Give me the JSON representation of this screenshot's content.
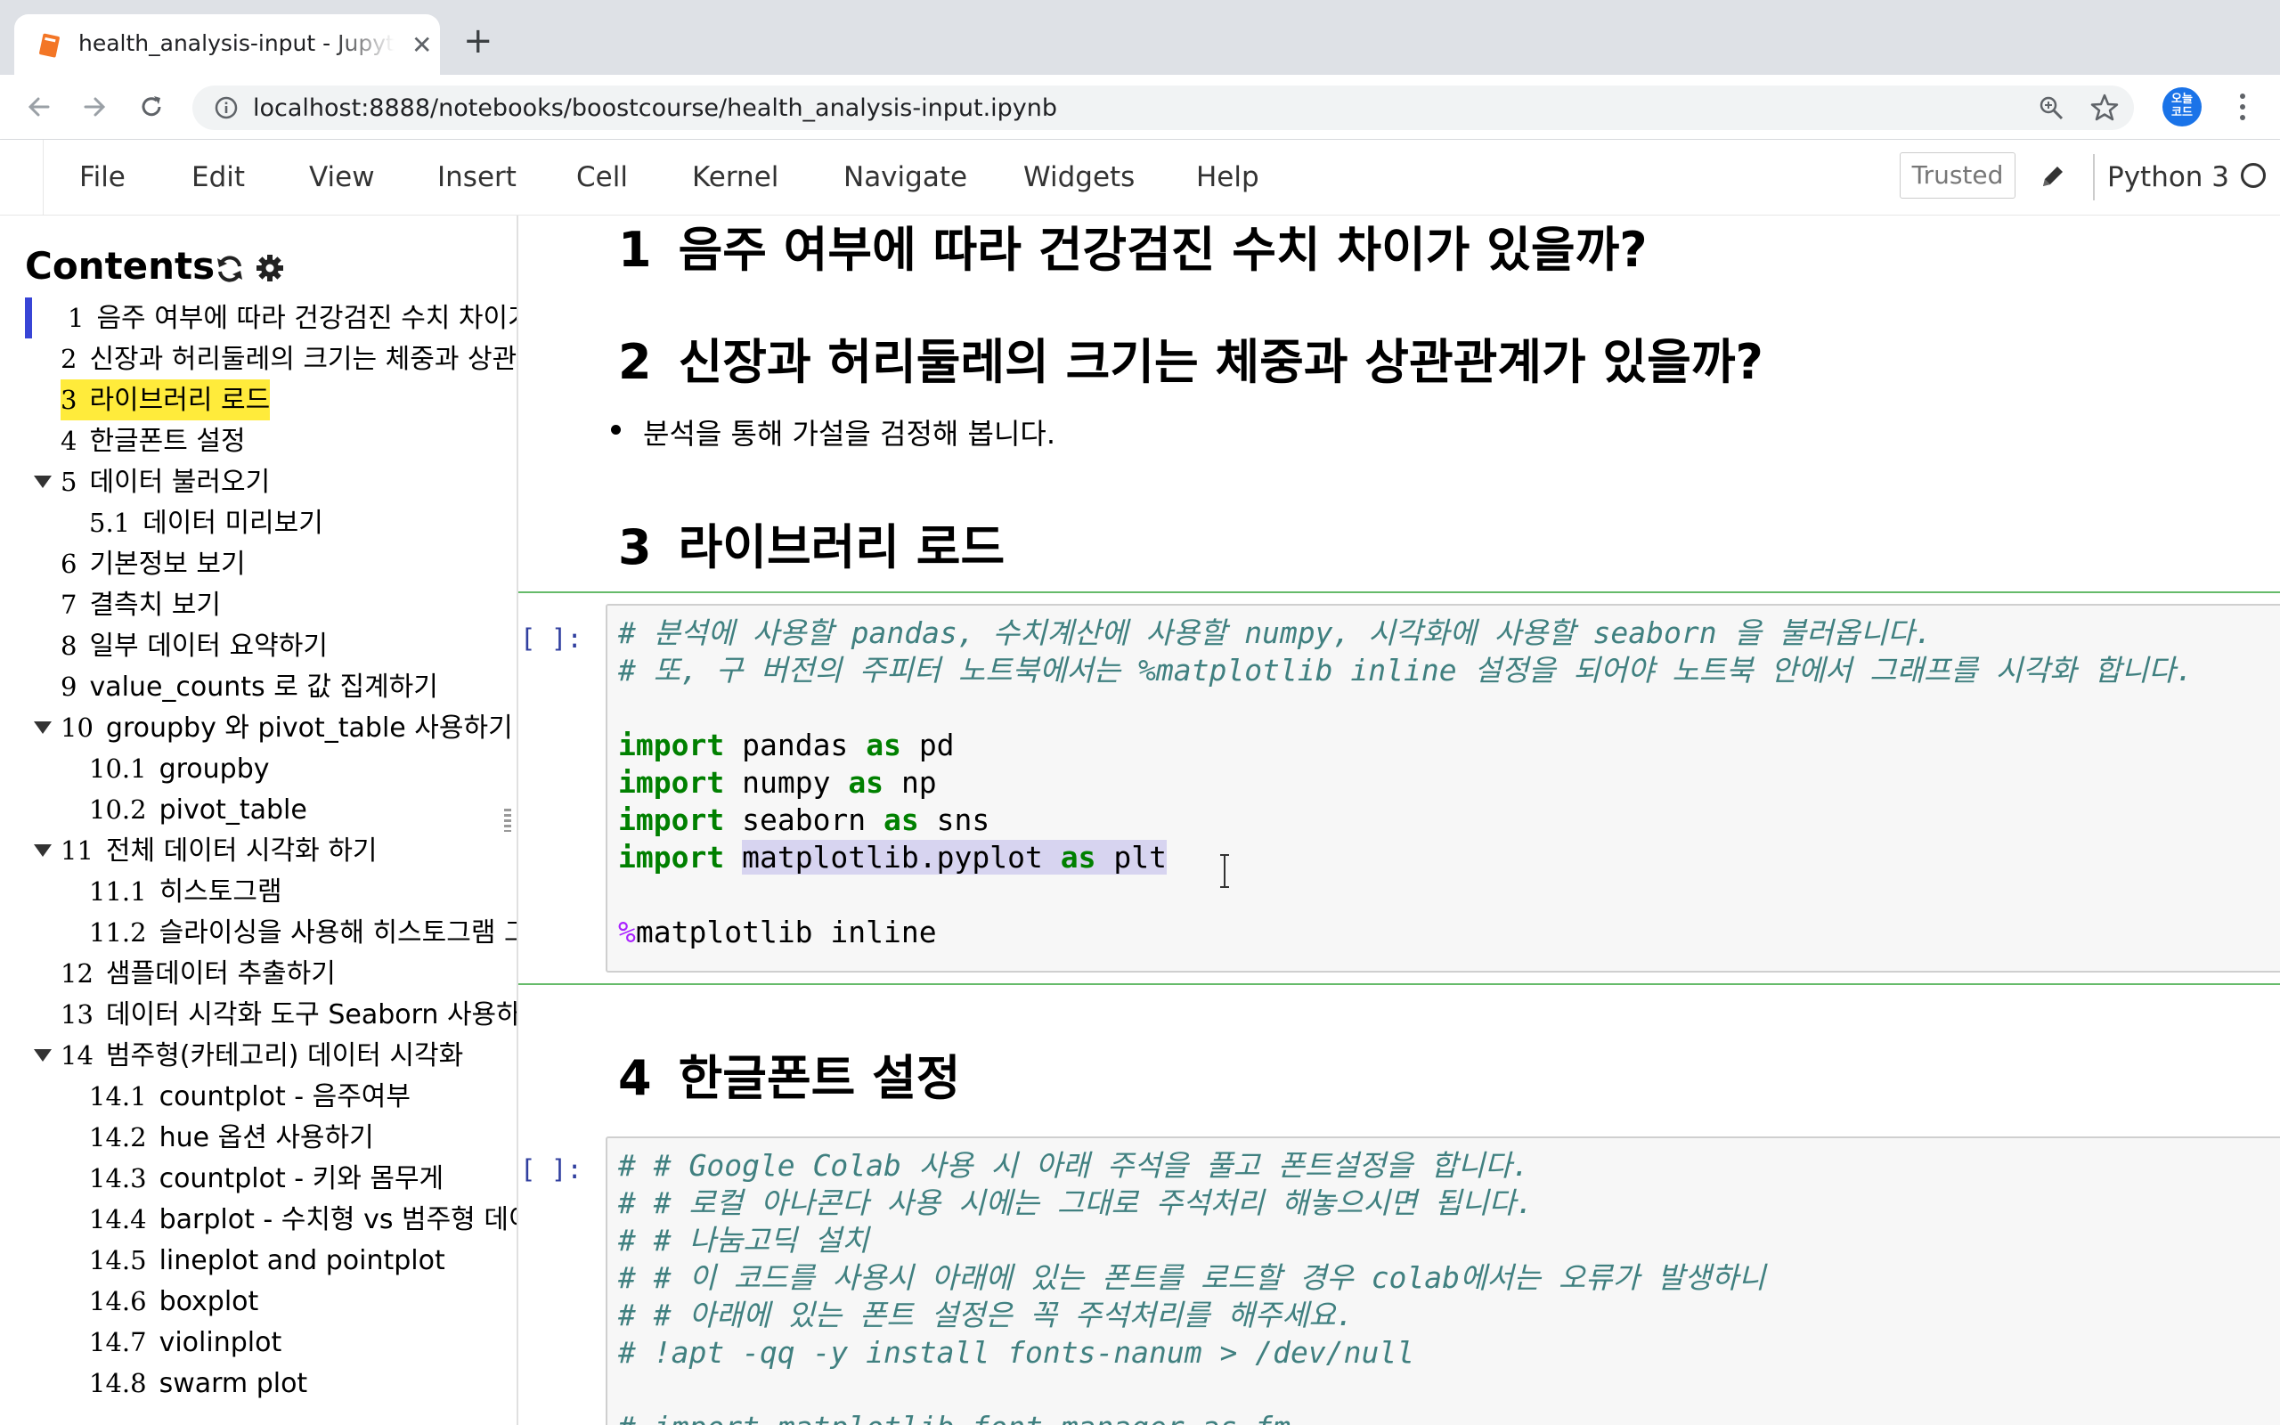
{
  "browser": {
    "tab_title": "health_analysis-input - Jupyter Notebook",
    "new_tab_symbol": "+",
    "close_symbol": "✕",
    "url": "localhost:8888/notebooks/boostcourse/health_analysis-input.ipynb",
    "profile_text": "오늘\n코드",
    "accent_color": "#1a73e8"
  },
  "menubar": {
    "items": [
      "File",
      "Edit",
      "View",
      "Insert",
      "Cell",
      "Kernel",
      "Navigate",
      "Widgets",
      "Help"
    ],
    "trusted_label": "Trusted",
    "kernel_name": "Python 3"
  },
  "toc": {
    "title": "Contents",
    "items": [
      {
        "num": "1",
        "label": "음주 여부에 따라 건강검진 수치 차이가 있을까?"
      },
      {
        "num": "2",
        "label": "신장과 허리둘레의 크기는 체중과 상관관계가 있을까?"
      },
      {
        "num": "3",
        "label": "라이브러리 로드"
      },
      {
        "num": "4",
        "label": "한글폰트 설정"
      },
      {
        "num": "5",
        "label": "데이터 불러오기"
      },
      {
        "num": "5.1",
        "label": "데이터 미리보기"
      },
      {
        "num": "6",
        "label": "기본정보 보기"
      },
      {
        "num": "7",
        "label": "결측치 보기"
      },
      {
        "num": "8",
        "label": "일부 데이터 요약하기"
      },
      {
        "num": "9",
        "label": "value_counts 로 값 집계하기"
      },
      {
        "num": "10",
        "label": "groupby 와 pivot_table 사용하기"
      },
      {
        "num": "10.1",
        "label": "groupby"
      },
      {
        "num": "10.2",
        "label": "pivot_table"
      },
      {
        "num": "11",
        "label": "전체 데이터 시각화 하기"
      },
      {
        "num": "11.1",
        "label": "히스토그램"
      },
      {
        "num": "11.2",
        "label": "슬라이싱을 사용해 히스토그램 그리기"
      },
      {
        "num": "12",
        "label": "샘플데이터 추출하기"
      },
      {
        "num": "13",
        "label": "데이터 시각화 도구 Seaborn 사용하기"
      },
      {
        "num": "14",
        "label": "범주형(카테고리) 데이터 시각화"
      },
      {
        "num": "14.1",
        "label": "countplot - 음주여부"
      },
      {
        "num": "14.2",
        "label": "hue 옵션 사용하기"
      },
      {
        "num": "14.3",
        "label": "countplot - 키와 몸무게"
      },
      {
        "num": "14.4",
        "label": "barplot - 수치형 vs 범주형 데이터"
      },
      {
        "num": "14.5",
        "label": "lineplot and pointplot"
      },
      {
        "num": "14.6",
        "label": "boxplot"
      },
      {
        "num": "14.7",
        "label": "violinplot"
      },
      {
        "num": "14.8",
        "label": "swarm plot"
      }
    ],
    "highlight_color": "#ffeb3b"
  },
  "notebook": {
    "headings": [
      {
        "num": "1",
        "text": "음주 여부에 따라 건강검진 수치 차이가 있을까?"
      },
      {
        "num": "2",
        "text": "신장과 허리둘레의 크기는 체중과 상관관계가 있을까?"
      },
      {
        "num": "3",
        "text": "라이브러리 로드"
      },
      {
        "num": "4",
        "text": "한글폰트 설정"
      }
    ],
    "bullet": "분석을 통해 가설을 검정해 봅니다.",
    "prompt": "[ ]:",
    "cell1": {
      "comment1": "# 분석에 사용할 pandas, 수치계산에 사용할 numpy, 시각화에 사용할 seaborn 을 불러옵니다.",
      "comment2": "# 또, 구 버전의 주피터 노트북에서는 %matplotlib inline 설정을 되어야 노트북 안에서 그래프를 시각화 합니다.",
      "kw_import": "import",
      "kw_as": "as",
      "imports": [
        {
          "module": "pandas",
          "alias": "pd"
        },
        {
          "module": "numpy",
          "alias": "np"
        },
        {
          "module": "seaborn",
          "alias": "sns"
        },
        {
          "module": "matplotlib.pyplot",
          "alias": "plt"
        }
      ],
      "magic_symbol": "%",
      "magic_rest": "matplotlib inline"
    },
    "cell2": {
      "lines": [
        "# # Google Colab 사용 시 아래 주석을 풀고 폰트설정을 합니다.",
        "# # 로컬 아나콘다 사용 시에는 그대로 주석처리 해놓으시면 됩니다.",
        "# # 나눔고딕 설치",
        "# # 이 코드를 사용시 아래에 있는 폰트를 로드할 경우 colab에서는 오류가 발생하니",
        "# # 아래에 있는 폰트 설정은 꼭 주석처리를 해주세요.",
        "# !apt -qq -y install fonts-nanum > /dev/null",
        "# import matplotlib.font_manager as fm"
      ]
    }
  }
}
